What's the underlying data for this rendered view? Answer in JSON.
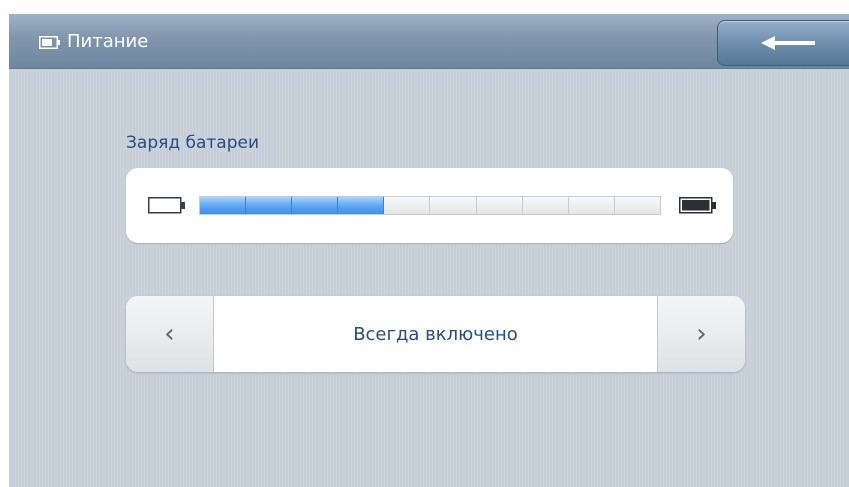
{
  "header": {
    "title": "Питание",
    "icon": "battery-icon",
    "back_icon": "back-arrow-icon"
  },
  "battery": {
    "label": "Заряд батареи",
    "segments_total": 10,
    "segments_filled": 4,
    "empty_icon": "battery-empty-icon",
    "full_icon": "battery-full-icon"
  },
  "mode_selector": {
    "value": "Всегда включено",
    "prev_icon": "chevron-left-icon",
    "next_icon": "chevron-right-icon"
  },
  "colors": {
    "accent_text": "#1e4f86",
    "header": "#7f96ad",
    "battery_fill": "#5fa8f2",
    "background": "#c6cfd8"
  }
}
